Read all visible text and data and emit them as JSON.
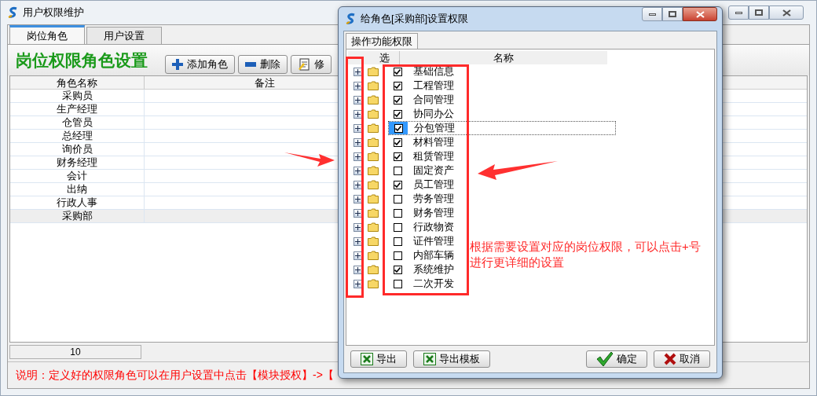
{
  "main_window": {
    "title": "用户权限维护",
    "tabs": [
      {
        "label": "岗位角色",
        "selected": true
      },
      {
        "label": "用户设置",
        "selected": false
      }
    ],
    "heading": "岗位权限角色设置",
    "toolbar": [
      {
        "label": "添加角色",
        "kind": "add"
      },
      {
        "label": "删除",
        "kind": "delete"
      },
      {
        "label": "修",
        "kind": "edit"
      }
    ],
    "table": {
      "columns": [
        "角色名称",
        "备注"
      ],
      "rows": [
        {
          "name": "采购员",
          "selected": false
        },
        {
          "name": "生产经理",
          "selected": false
        },
        {
          "name": "仓管员",
          "selected": false
        },
        {
          "name": "总经理",
          "selected": false
        },
        {
          "name": "询价员",
          "selected": false
        },
        {
          "name": "财务经理",
          "selected": false
        },
        {
          "name": "会计",
          "selected": false
        },
        {
          "name": "出纳",
          "selected": false
        },
        {
          "name": "行政人事",
          "selected": false
        },
        {
          "name": "采购部",
          "selected": true
        }
      ]
    },
    "count": "10",
    "note": "说明：定义好的权限角色可以在用户设置中点击【模块授权】->【"
  },
  "dialog": {
    "title": "给角色[采购部]设置权限",
    "tab": "操作功能权限",
    "columns": [
      "选",
      "名称"
    ],
    "items": [
      {
        "name": "基础信息",
        "checked": true,
        "selected": false
      },
      {
        "name": "工程管理",
        "checked": true,
        "selected": false
      },
      {
        "name": "合同管理",
        "checked": true,
        "selected": false
      },
      {
        "name": "协同办公",
        "checked": true,
        "selected": false
      },
      {
        "name": "分包管理",
        "checked": true,
        "selected": true
      },
      {
        "name": "材料管理",
        "checked": true,
        "selected": false
      },
      {
        "name": "租赁管理",
        "checked": true,
        "selected": false
      },
      {
        "name": "固定资产",
        "checked": false,
        "selected": false
      },
      {
        "name": "员工管理",
        "checked": true,
        "selected": false
      },
      {
        "name": "劳务管理",
        "checked": false,
        "selected": false
      },
      {
        "name": "财务管理",
        "checked": false,
        "selected": false
      },
      {
        "name": "行政物资",
        "checked": false,
        "selected": false
      },
      {
        "name": "证件管理",
        "checked": false,
        "selected": false
      },
      {
        "name": "内部车辆",
        "checked": false,
        "selected": false
      },
      {
        "name": "系统维护",
        "checked": true,
        "selected": false
      },
      {
        "name": "二次开发",
        "checked": false,
        "selected": false
      }
    ],
    "buttons": [
      {
        "label": "导出",
        "kind": "excel"
      },
      {
        "label": "导出模板",
        "kind": "excel"
      },
      {
        "label": "确定",
        "kind": "ok"
      },
      {
        "label": "取消",
        "kind": "cancel"
      }
    ]
  },
  "annotation": {
    "lines": [
      "根据需要设置对应的岗位权限，可以点击+号",
      "进行更详细的设置"
    ]
  }
}
